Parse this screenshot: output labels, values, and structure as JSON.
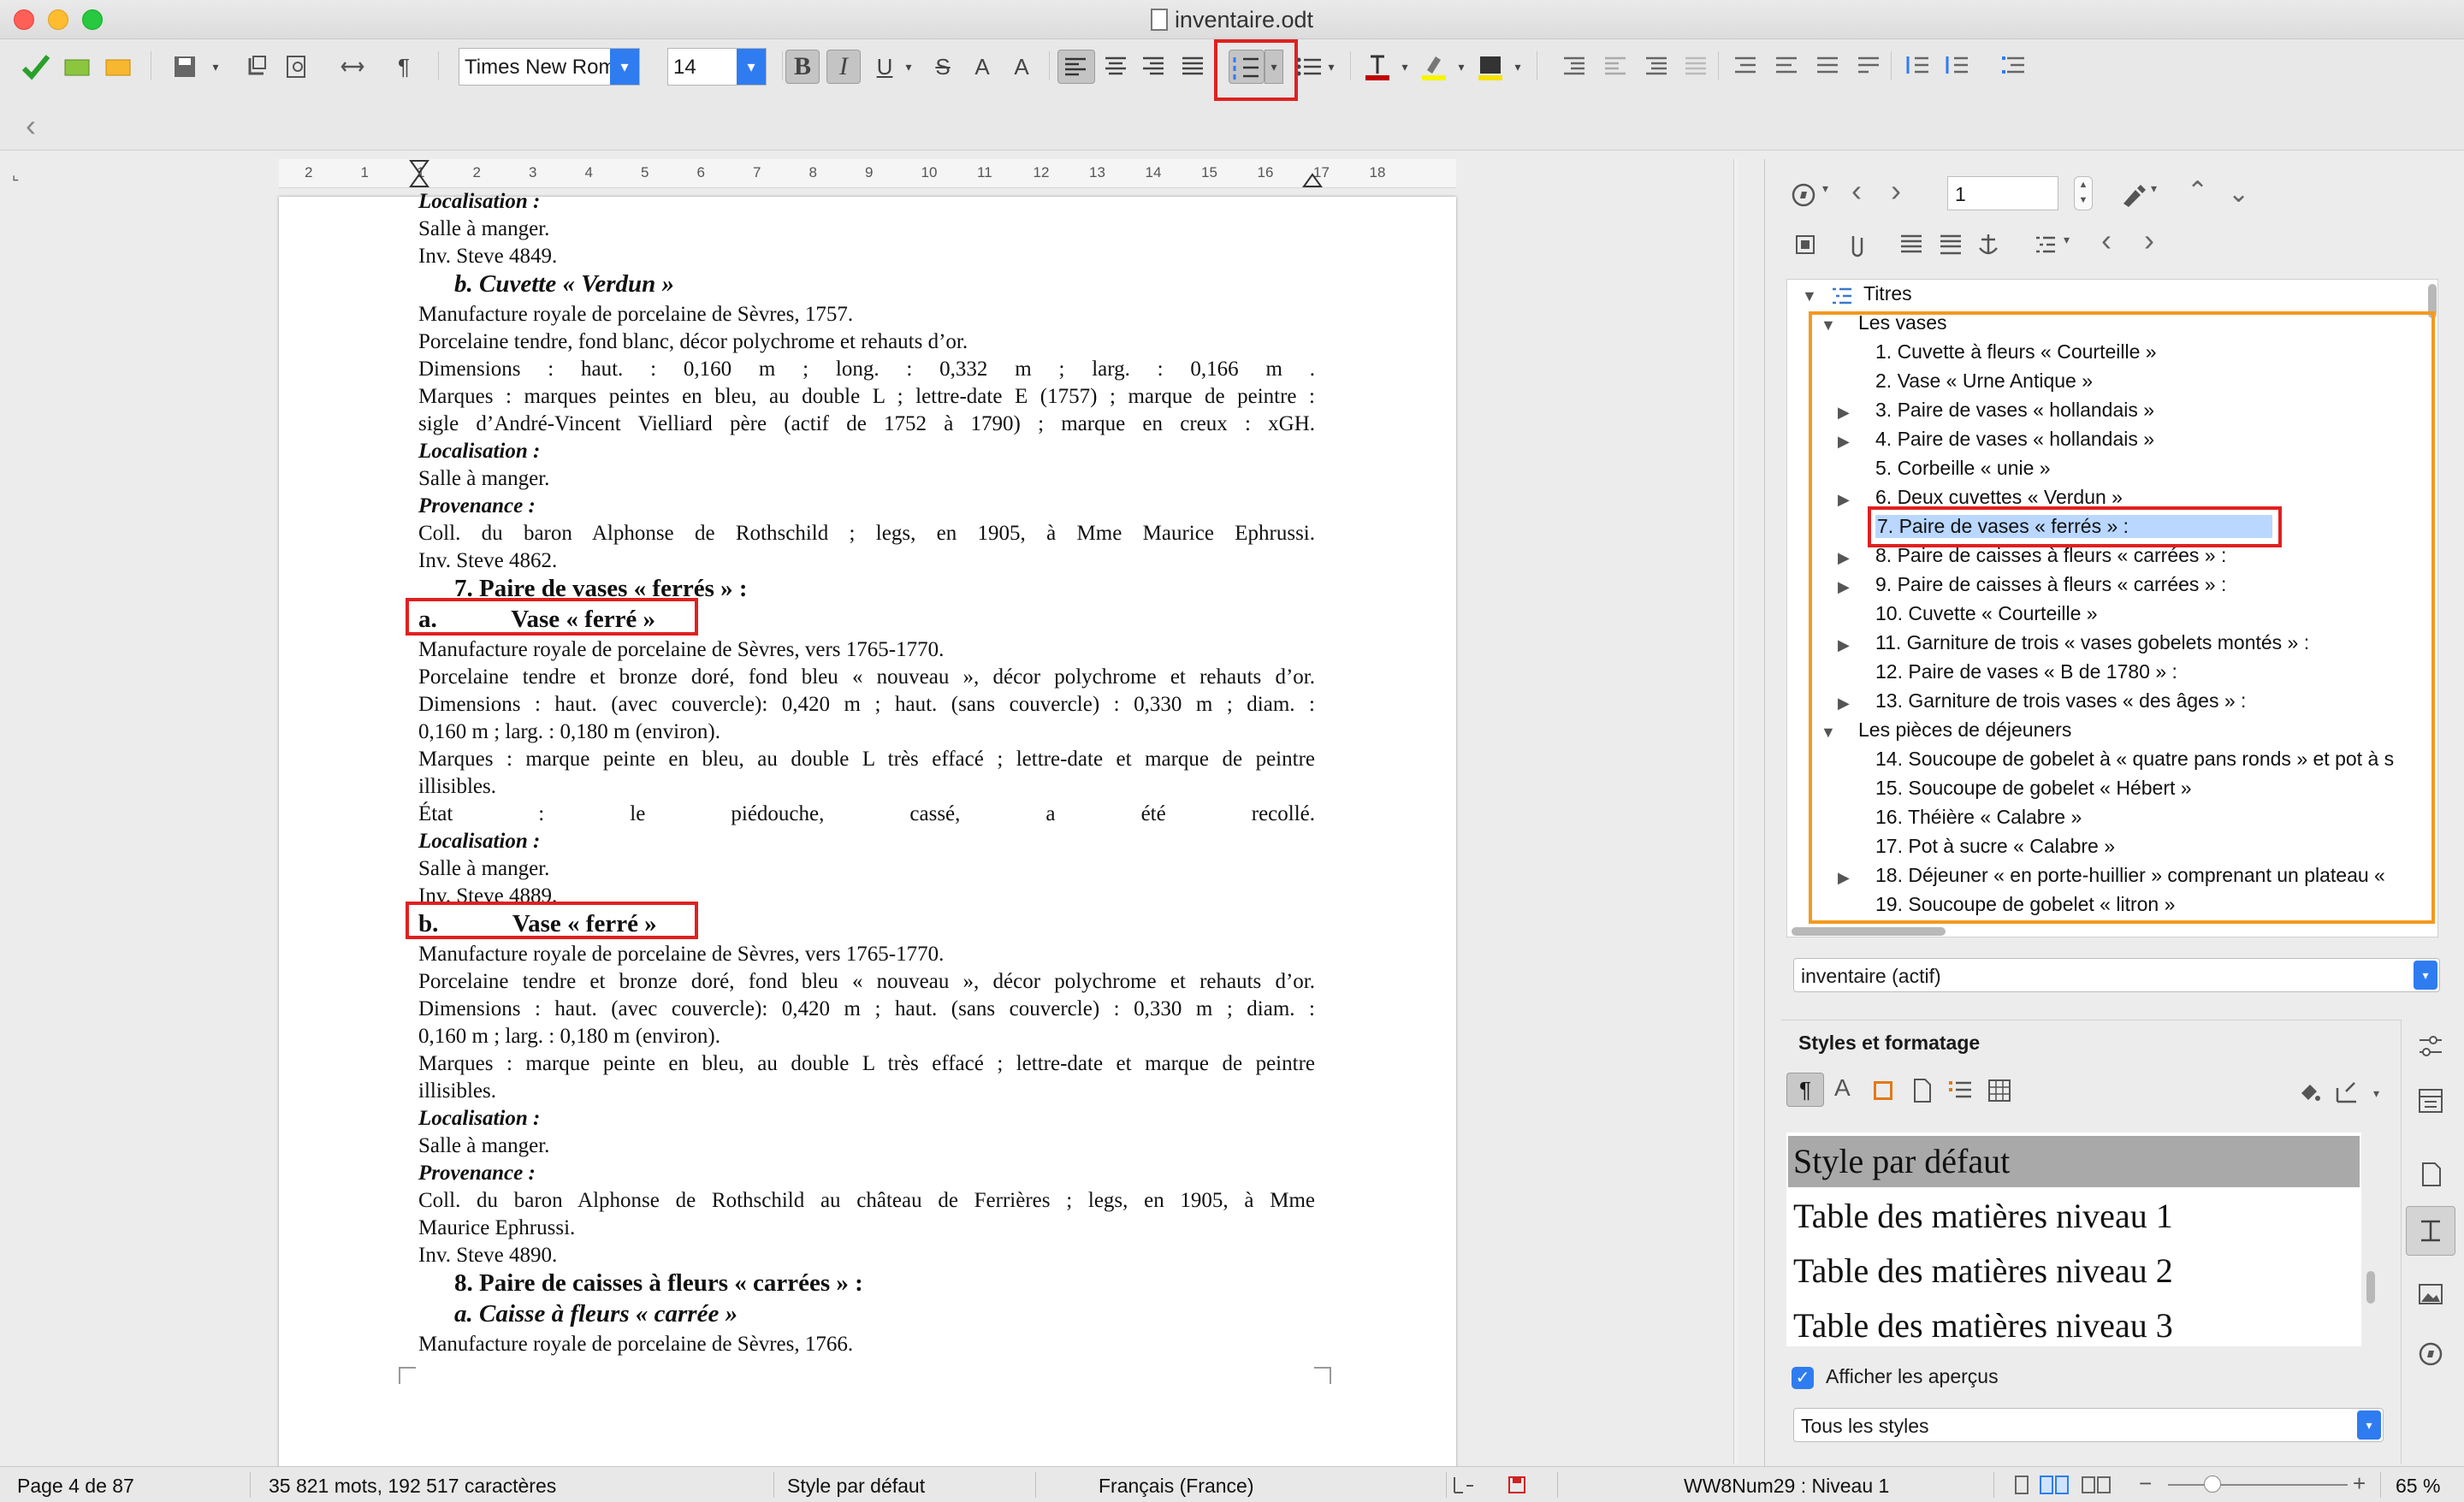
{
  "window": {
    "title": "inventaire.odt"
  },
  "toolbar": {
    "font_name": "Times New Roman",
    "font_size": "14",
    "bold_label": "B",
    "italic_label": "I",
    "underline_label": "U",
    "strike_label": "S",
    "superscript_label": "A",
    "subscript_label": "A",
    "pilcrow": "¶",
    "back_arrow": "‹"
  },
  "ruler": {
    "ticks": [
      "2",
      "1",
      "1",
      "2",
      "3",
      "4",
      "5",
      "6",
      "7",
      "8",
      "9",
      "10",
      "11",
      "12",
      "13",
      "14",
      "15",
      "16",
      "17",
      "18"
    ]
  },
  "document": {
    "lines": [
      {
        "text": "Localisation :",
        "style": "bi"
      },
      {
        "text": "Salle à manger.",
        "style": "n"
      },
      {
        "text": "Inv. Steve 4849.",
        "style": "n"
      },
      {
        "text": "b. Cuvette « Verdun »",
        "style": "h2"
      },
      {
        "text": "Manufacture royale de porcelaine de Sèvres, 1757.",
        "style": "n"
      },
      {
        "text": "Porcelaine tendre, fond blanc, décor polychrome et rehauts d’or.",
        "style": "n"
      },
      {
        "text": "Dimensions : haut. : 0,160 m ; long. : 0,332 m ; larg. : 0,166 m .",
        "style": "dim"
      },
      {
        "text": "Marques : marques peintes en bleu, au double L ; lettre-date E (1757) ; marque de peintre :",
        "style": "mar"
      },
      {
        "text": "sigle d’André-Vincent Vielliard père (actif de 1752 à 1790) ; marque en creux : xGH.",
        "style": "n"
      },
      {
        "text": "Localisation :",
        "style": "bi"
      },
      {
        "text": "Salle à manger.",
        "style": "n"
      },
      {
        "text": "Provenance :",
        "style": "bi"
      },
      {
        "text": "Coll. du baron Alphonse de Rothschild ; legs, en 1905, à Mme Maurice Ephrussi.",
        "style": "n"
      },
      {
        "text": "Inv. Steve 4862.",
        "style": "n"
      },
      {
        "text": "7. Paire de vases « ferrés » :",
        "style": "h1"
      },
      {
        "text": "a.            Vase « ferré »",
        "style": "h3"
      },
      {
        "text": "Manufacture royale de porcelaine de Sèvres, vers 1765-1770.",
        "style": "n"
      },
      {
        "text": "Porcelaine tendre et bronze doré, fond bleu « nouveau », décor polychrome et rehauts d’or.",
        "style": "n"
      },
      {
        "text": "Dimensions : haut. (avec couvercle): 0,420 m ; haut. (sans couvercle) : 0,330 m ; diam. :",
        "style": "dim"
      },
      {
        "text": "0,160 m ; larg. : 0,180 m (environ).",
        "style": "n"
      },
      {
        "text": "Marques : marque peinte en bleu, au double L très effacé ; lettre-date et marque de peintre",
        "style": "mar"
      },
      {
        "text": "illisibles.",
        "style": "n"
      },
      {
        "text": "État : le piédouche, cassé, a été recollé.",
        "style": "etat"
      },
      {
        "text": "Localisation :",
        "style": "bi"
      },
      {
        "text": "Salle à manger.",
        "style": "n"
      },
      {
        "text": "Inv. Steve 4889.",
        "style": "n"
      },
      {
        "text": "b.            Vase « ferré »",
        "style": "h3"
      },
      {
        "text": "Manufacture royale de porcelaine de Sèvres, vers 1765-1770.",
        "style": "n"
      },
      {
        "text": "Porcelaine tendre et bronze doré, fond bleu « nouveau », décor polychrome et rehauts d’or.",
        "style": "n"
      },
      {
        "text": "Dimensions : haut. (avec couvercle):  0,420 m ; haut. (sans couvercle) : 0,330 m ; diam. :",
        "style": "dim"
      },
      {
        "text": "0,160 m ; larg. : 0,180 m (environ).",
        "style": "n"
      },
      {
        "text": "Marques : marque peinte en bleu, au double L très effacé ; lettre-date et marque de peintre",
        "style": "mar"
      },
      {
        "text": "illisibles.",
        "style": "n"
      },
      {
        "text": "Localisation :",
        "style": "bi"
      },
      {
        "text": "Salle à manger.",
        "style": "n"
      },
      {
        "text": "Provenance :",
        "style": "bi"
      },
      {
        "text": "Coll. du baron Alphonse de Rothschild au château de Ferrières ; legs, en 1905, à Mme",
        "style": "n"
      },
      {
        "text": "Maurice Ephrussi.",
        "style": "n"
      },
      {
        "text": "Inv. Steve 4890.",
        "style": "n"
      },
      {
        "text": "8. Paire de caisses à fleurs « carrées » :",
        "style": "h1"
      },
      {
        "text": "a. Caisse à fleurs « carrée »",
        "style": "h2"
      },
      {
        "text": "Manufacture royale de porcelaine de Sèvres, 1766.",
        "style": "n"
      }
    ]
  },
  "navigator": {
    "page_value": "1",
    "root": "Titres",
    "items": [
      {
        "label": "Les vases",
        "level": 1,
        "expander": "open"
      },
      {
        "label": "1. Cuvette à fleurs « Courteille »",
        "level": 2,
        "expander": ""
      },
      {
        "label": "2. Vase « Urne Antique »",
        "level": 2,
        "expander": ""
      },
      {
        "label": "3. Paire de vases « hollandais »",
        "level": 2,
        "expander": "closed"
      },
      {
        "label": "4. Paire de vases « hollandais »",
        "level": 2,
        "expander": "closed"
      },
      {
        "label": "5. Corbeille « unie »",
        "level": 2,
        "expander": ""
      },
      {
        "label": "6. Deux cuvettes « Verdun »",
        "level": 2,
        "expander": "closed"
      },
      {
        "label": "7. Paire de vases « ferrés » :",
        "level": 2,
        "expander": "",
        "selected": true
      },
      {
        "label": "8. Paire de caisses à fleurs « carrées » :",
        "level": 2,
        "expander": "closed"
      },
      {
        "label": "9. Paire de caisses à fleurs « carrées » :",
        "level": 2,
        "expander": "closed"
      },
      {
        "label": "10. Cuvette « Courteille »",
        "level": 2,
        "expander": ""
      },
      {
        "label": "11. Garniture de trois « vases gobelets montés » :",
        "level": 2,
        "expander": "closed"
      },
      {
        "label": "12. Paire de vases « B de 1780 » :",
        "level": 2,
        "expander": ""
      },
      {
        "label": "13. Garniture de trois vases « des âges » :",
        "level": 2,
        "expander": "closed"
      },
      {
        "label": "Les pièces de déjeuners",
        "level": 1,
        "expander": "open"
      },
      {
        "label": "14. Soucoupe de gobelet à « quatre pans ronds » et pot à s",
        "level": 2,
        "expander": ""
      },
      {
        "label": "15. Soucoupe de gobelet « Hébert »",
        "level": 2,
        "expander": ""
      },
      {
        "label": "16. Théière « Calabre »",
        "level": 2,
        "expander": ""
      },
      {
        "label": "17. Pot à sucre « Calabre »",
        "level": 2,
        "expander": ""
      },
      {
        "label": "18. Déjeuner « en porte-huillier » comprenant un plateau «",
        "level": 2,
        "expander": "closed"
      },
      {
        "label": "19. Soucoupe de gobelet « litron »",
        "level": 2,
        "expander": ""
      }
    ],
    "document_select": "inventaire (actif)"
  },
  "styles_panel": {
    "title": "Styles et formatage",
    "items": [
      "Style par défaut",
      "Table des matières niveau 1",
      "Table des matières niveau 2",
      "Table des matières niveau 3"
    ],
    "preview_label": "Afficher les aperçus",
    "filter": "Tous les styles"
  },
  "statusbar": {
    "page": "Page 4 de 87",
    "words": "35 821 mots, 192 517 caractères",
    "style": "Style par défaut",
    "language": "Français (France)",
    "list_level": "WW8Num29 : Niveau 1",
    "zoom": "65 %"
  },
  "colors": {
    "highlight_red": "#e02020",
    "highlight_orange": "#f39a1e",
    "accent_blue": "#2f7cf0",
    "selection": "#b9d7ff"
  }
}
